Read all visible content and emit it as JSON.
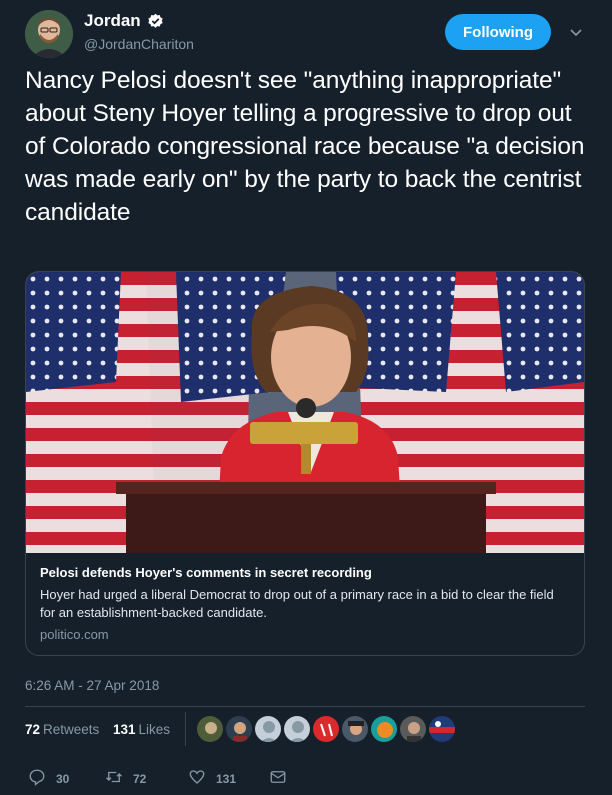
{
  "author": {
    "name": "Jordan",
    "handle": "@JordanChariton",
    "verified": true
  },
  "follow_button": {
    "label": "Following"
  },
  "tweet": {
    "text": "Nancy Pelosi doesn't see \"anything inappropriate\" about Steny Hoyer telling a progressive to drop out of Colorado congressional race because \"a decision was made early on\" by the party to back the centrist candidate"
  },
  "card": {
    "title": "Pelosi defends Hoyer's comments in secret recording",
    "description": "Hoyer had urged a liberal Democrat to drop out of a primary race in a bid to clear the field for an establishment-backed candidate.",
    "domain": "politico.com"
  },
  "timestamp": "6:26 AM - 27 Apr 2018",
  "stats": {
    "retweets_count": "72",
    "retweets_label": "Retweets",
    "likes_count": "131",
    "likes_label": "Likes"
  },
  "actions": {
    "reply_count": "30",
    "retweet_count": "72",
    "like_count": "131"
  },
  "colors": {
    "background": "#15202b",
    "accent": "#1da1f2",
    "muted": "#8899a6",
    "border": "#38444d"
  },
  "icons": [
    "verified-badge-icon",
    "chevron-down-icon",
    "reply-icon",
    "retweet-icon",
    "like-icon",
    "direct-message-icon"
  ]
}
